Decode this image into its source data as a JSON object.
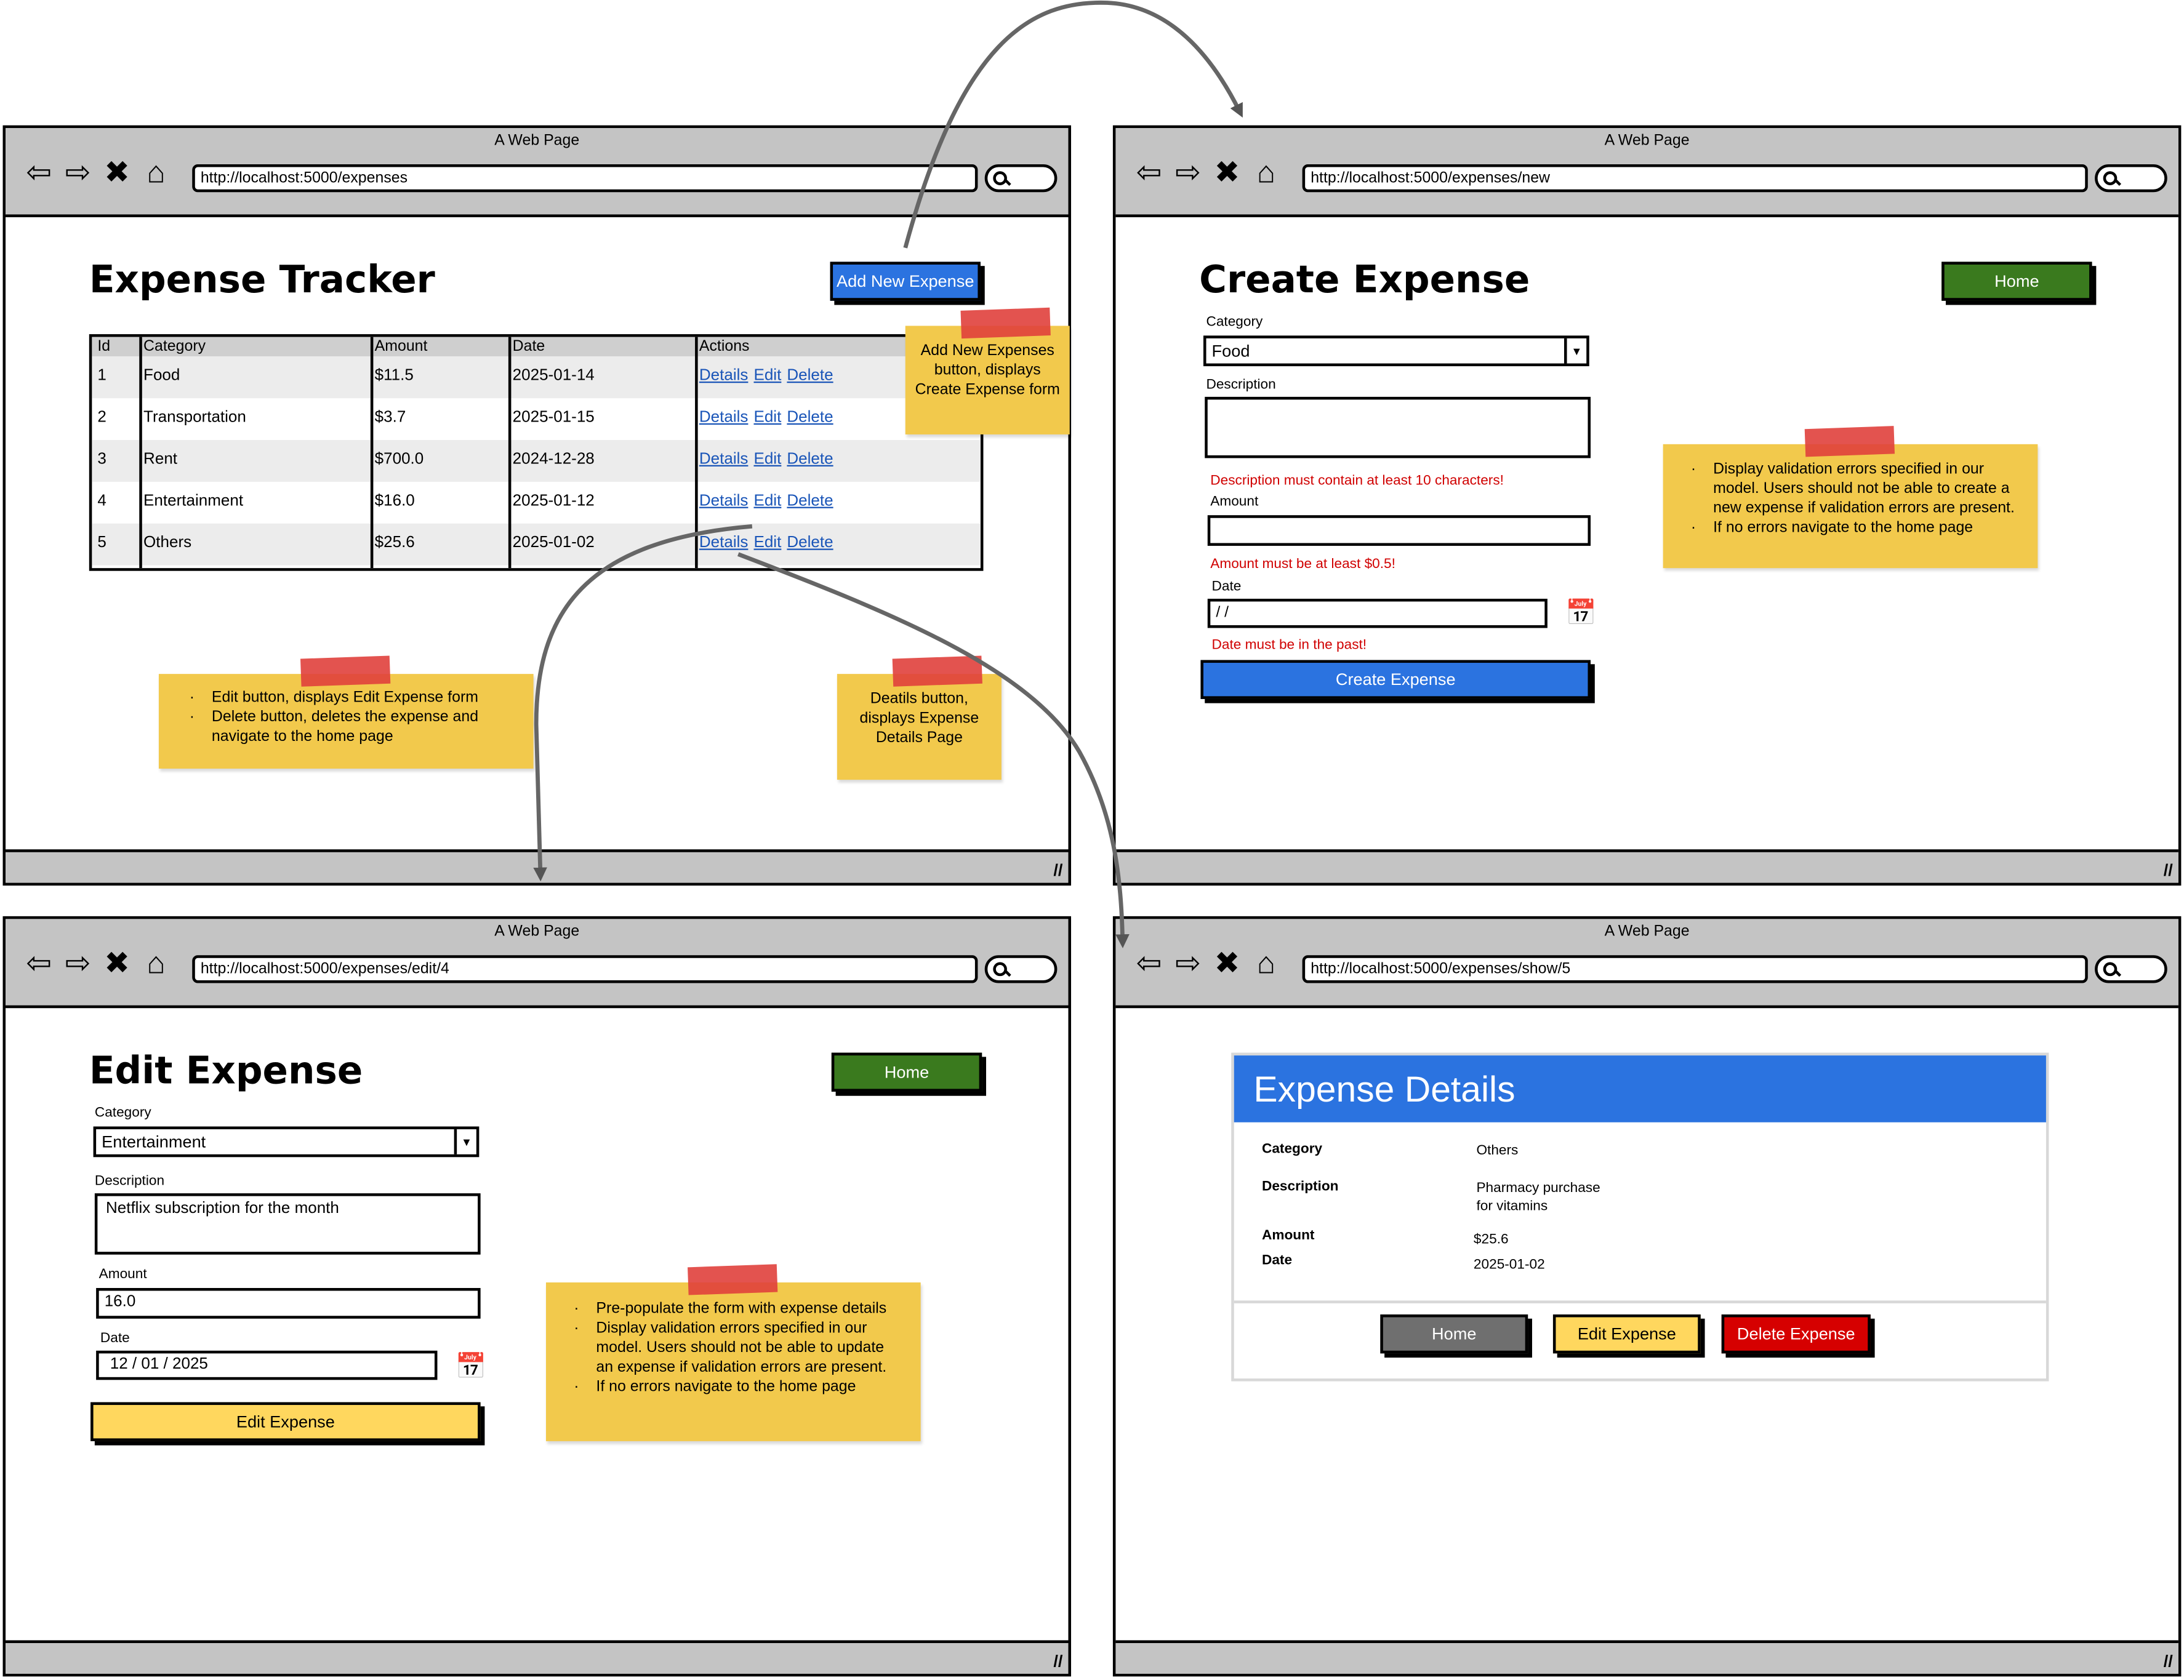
{
  "windows": {
    "list": {
      "title": "A Web Page",
      "url": "http://localhost:5000/expenses",
      "heading": "Expense Tracker",
      "add_button": "Add New Expense",
      "table": {
        "headers": [
          "Id",
          "Category",
          "Amount",
          "Date",
          "Actions"
        ],
        "rows": [
          {
            "id": "1",
            "category": "Food",
            "amount": "$11.5",
            "date": "2025-01-14"
          },
          {
            "id": "2",
            "category": "Transportation",
            "amount": "$3.7",
            "date": "2025-01-15"
          },
          {
            "id": "3",
            "category": "Rent",
            "amount": "$700.0",
            "date": "2024-12-28"
          },
          {
            "id": "4",
            "category": "Entertainment",
            "amount": "$16.0",
            "date": "2025-01-12"
          },
          {
            "id": "5",
            "category": "Others",
            "amount": "$25.6",
            "date": "2025-01-02"
          }
        ],
        "actions": {
          "details": "Details",
          "edit": "Edit",
          "delete": "Delete"
        }
      },
      "notes": {
        "add": "Add New Expenses button, displays Create Expense form",
        "edit_delete": [
          "Edit button, displays Edit Expense form",
          "Delete button, deletes the expense and navigate to the home page"
        ],
        "details": "Deatils button, displays Expense Details Page"
      }
    },
    "create": {
      "title": "A Web Page",
      "url": "http://localhost:5000/expenses/new",
      "heading": "Create Expense",
      "home_button": "Home",
      "category_label": "Category",
      "category_value": "Food",
      "description_label": "Description",
      "description_error": "Description must contain at least 10 characters!",
      "amount_label": "Amount",
      "amount_error": "Amount must be at least $0.5!",
      "date_label": "Date",
      "date_value": " /  /",
      "date_error": "Date must be in the past!",
      "submit_button": "Create Expense",
      "note": [
        "Display validation errors specified in our model. Users should not be able to create a new expense if validation errors are present.",
        "If no errors navigate to the home page"
      ]
    },
    "edit": {
      "title": "A Web Page",
      "url": "http://localhost:5000/expenses/edit/4",
      "heading": "Edit Expense",
      "home_button": "Home",
      "category_label": "Category",
      "category_value": "Entertainment",
      "description_label": "Description",
      "description_value": "Netflix subscription for the month",
      "amount_label": "Amount",
      "amount_value": "16.0",
      "date_label": "Date",
      "date_value": "12 / 01 / 2025",
      "submit_button": "Edit Expense",
      "note": [
        "Pre-populate the form with expense details",
        "Display validation errors specified in our model. Users should not be able to update an expense if validation errors are present.",
        "If no errors navigate to the home page"
      ]
    },
    "show": {
      "title": "A Web Page",
      "url": "http://localhost:5000/expenses/show/5",
      "card_title": "Expense Details",
      "category_label": "Category",
      "category_value": "Others",
      "description_label": "Description",
      "description_value": "Pharmacy purchase\nfor vitamins",
      "amount_label": "Amount",
      "amount_value": "$25.6",
      "date_label": "Date",
      "date_value": "2025-01-02",
      "home_button": "Home",
      "edit_button": "Edit Expense",
      "delete_button": "Delete Expense"
    }
  },
  "icons": {
    "back": "back-arrow-icon",
    "forward": "forward-arrow-icon",
    "stop": "close-x-icon",
    "home": "home-icon",
    "search": "search-icon",
    "calendar": "calendar-icon",
    "dropdown": "dropdown-arrow-icon",
    "resize": "resize-grip-icon"
  },
  "colors": {
    "window_chrome": "#c4c4c4",
    "primary_blue": "#2b73e0",
    "home_green": "#3a7a1e",
    "edit_yellow": "#ffd75e",
    "delete_red": "#d60000",
    "gray_button": "#6f6f6f",
    "sticky_note": "#f2c94c",
    "tape": "#e0403c",
    "error_red": "#d00000",
    "link_blue": "#1a55b8"
  }
}
